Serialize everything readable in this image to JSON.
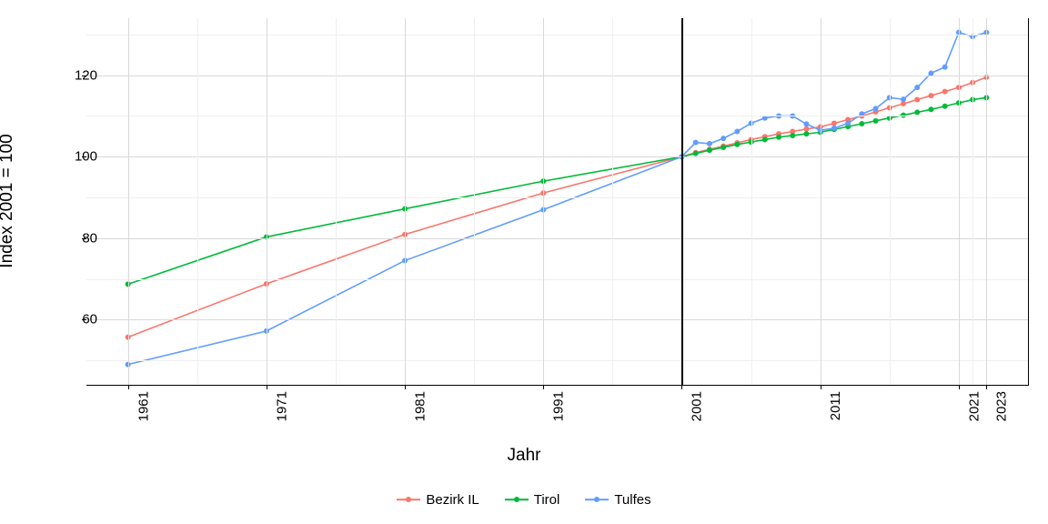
{
  "chart_data": {
    "type": "line",
    "title": "",
    "xlabel": "Jahr",
    "ylabel": "Index 2001 = 100",
    "xlim": [
      1958,
      2026
    ],
    "ylim": [
      44,
      134
    ],
    "x_ticks": [
      1961,
      1971,
      1981,
      1991,
      2001,
      2011,
      2021,
      2023
    ],
    "y_ticks": [
      60,
      80,
      100,
      120
    ],
    "reference_line_x": 2001,
    "series": [
      {
        "name": "Bezirk IL",
        "color": "#F8766D",
        "x": [
          1961,
          1971,
          1981,
          1991,
          2001,
          2002,
          2003,
          2004,
          2005,
          2006,
          2007,
          2008,
          2009,
          2010,
          2011,
          2012,
          2013,
          2014,
          2015,
          2016,
          2017,
          2018,
          2019,
          2020,
          2021,
          2022,
          2023
        ],
        "values": [
          55.7,
          68.8,
          80.9,
          91.1,
          100.0,
          101.0,
          101.8,
          102.6,
          103.4,
          104.2,
          104.9,
          105.6,
          106.2,
          106.8,
          107.3,
          108.2,
          109.1,
          110.0,
          111.0,
          112.0,
          113.0,
          114.0,
          115.0,
          116.0,
          117.0,
          118.2,
          119.5
        ]
      },
      {
        "name": "Tirol",
        "color": "#00BA38",
        "x": [
          1961,
          1971,
          1981,
          1991,
          2001,
          2002,
          2003,
          2004,
          2005,
          2006,
          2007,
          2008,
          2009,
          2010,
          2011,
          2012,
          2013,
          2014,
          2015,
          2016,
          2017,
          2018,
          2019,
          2020,
          2021,
          2022,
          2023
        ],
        "values": [
          68.7,
          80.3,
          87.2,
          94.0,
          100.0,
          100.8,
          101.6,
          102.3,
          103.0,
          103.6,
          104.2,
          104.8,
          105.2,
          105.6,
          106.0,
          106.7,
          107.4,
          108.1,
          108.8,
          109.5,
          110.2,
          110.9,
          111.6,
          112.4,
          113.2,
          114.0,
          114.5
        ]
      },
      {
        "name": "Tulfes",
        "color": "#619CFF",
        "x": [
          1961,
          1971,
          1981,
          1991,
          2001,
          2002,
          2003,
          2004,
          2005,
          2006,
          2007,
          2008,
          2009,
          2010,
          2011,
          2012,
          2013,
          2014,
          2015,
          2016,
          2017,
          2018,
          2019,
          2020,
          2021,
          2022,
          2023
        ],
        "values": [
          49.0,
          57.2,
          74.5,
          87.0,
          100.0,
          103.5,
          103.2,
          104.5,
          106.2,
          108.2,
          109.5,
          110.0,
          110.0,
          108.0,
          106.5,
          107.0,
          108.2,
          110.5,
          111.8,
          114.5,
          114.1,
          117.0,
          120.5,
          122.0,
          130.5,
          129.5,
          130.5
        ]
      }
    ],
    "legend_position": "bottom",
    "grid": true
  }
}
